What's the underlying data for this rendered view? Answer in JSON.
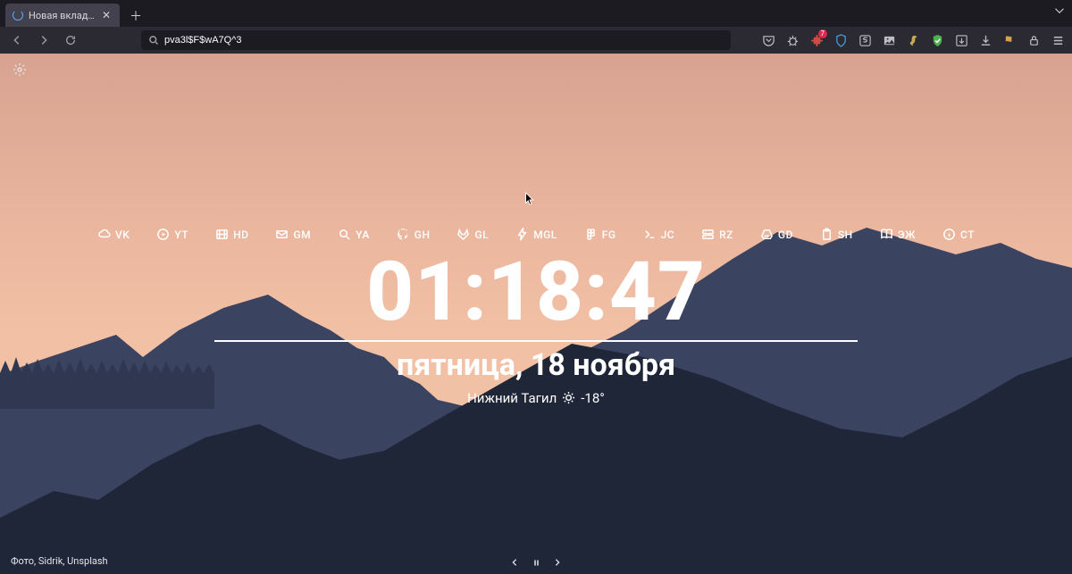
{
  "tab": {
    "title": "Новая вкладка"
  },
  "urlbar": {
    "value": "pva3l$F$wA7Q^3"
  },
  "shortcuts": [
    {
      "label": "VK",
      "icon": "cloud"
    },
    {
      "label": "YT",
      "icon": "play"
    },
    {
      "label": "HD",
      "icon": "film"
    },
    {
      "label": "GM",
      "icon": "mail"
    },
    {
      "label": "YA",
      "icon": "search"
    },
    {
      "label": "GH",
      "icon": "github"
    },
    {
      "label": "GL",
      "icon": "gitlab"
    },
    {
      "label": "MGL",
      "icon": "bolt"
    },
    {
      "label": "FG",
      "icon": "figma"
    },
    {
      "label": "JC",
      "icon": "terminal"
    },
    {
      "label": "RZ",
      "icon": "server"
    },
    {
      "label": "GD",
      "icon": "drive"
    },
    {
      "label": "SH",
      "icon": "clipboard"
    },
    {
      "label": "ЭЖ",
      "icon": "book"
    },
    {
      "label": "CT",
      "icon": "info"
    }
  ],
  "clock": {
    "time": "01:18:47",
    "date": "пятница, 18 ноября"
  },
  "weather": {
    "city": "Нижний Тагил",
    "temp": "-18°"
  },
  "attribution": "Фото, Sidrik, Unsplash",
  "ext_badge": "7"
}
